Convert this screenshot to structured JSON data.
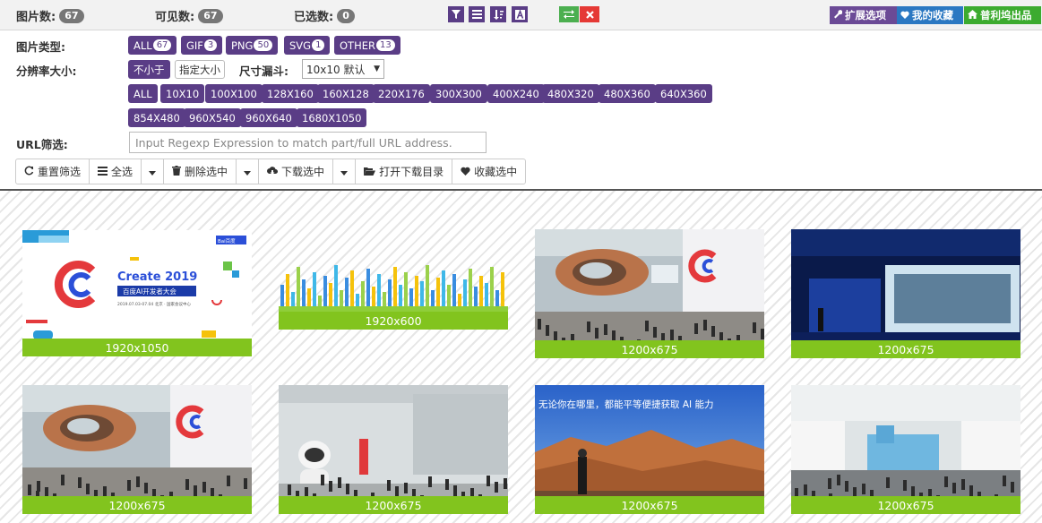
{
  "stats": {
    "images_label": "图片数:",
    "images_count": "67",
    "visible_label": "可见数:",
    "visible_count": "67",
    "selected_label": "已选数:",
    "selected_count": "0"
  },
  "ext_buttons": {
    "extend": "扩展选项",
    "favorites": "我的收藏",
    "brand": "普利坞出品"
  },
  "filters": {
    "type_label": "图片类型:",
    "types": [
      {
        "label": "ALL",
        "count": "67"
      },
      {
        "label": "GIF",
        "count": "3"
      },
      {
        "label": "PNG",
        "count": "50"
      },
      {
        "label": "SVG",
        "count": "1"
      },
      {
        "label": "OTHER",
        "count": "13"
      }
    ],
    "resolution_label": "分辨率大小:",
    "res_mode_active": "不小于",
    "res_mode_other": "指定大小",
    "funnel_label": "尺寸漏斗:",
    "funnel_value": "10x10 默认",
    "sizes_row1": [
      "ALL",
      "10X10",
      "100X100",
      "128X160",
      "160X128",
      "220X176",
      "300X300",
      "400X240",
      "480X320",
      "480X360",
      "640X360"
    ],
    "sizes_row2": [
      "854X480",
      "960X540",
      "960X640",
      "1680X1050"
    ],
    "url_label": "URL筛选:",
    "url_placeholder": "Input Regexp Expression to match part/full URL address."
  },
  "actions": {
    "reset": "重置筛选",
    "select_all": "全选",
    "delete_selected": "删除选中",
    "download_selected": "下载选中",
    "open_download_dir": "打开下载目录",
    "favorite_selected": "收藏选中"
  },
  "thumbnails": [
    {
      "size": "1920x1050"
    },
    {
      "size": "1920x600"
    },
    {
      "size": "1200x675"
    },
    {
      "size": "1200x675"
    },
    {
      "size": "1200x675"
    },
    {
      "size": "1200x675"
    },
    {
      "size": "1200x675"
    },
    {
      "size": "1200x675"
    }
  ],
  "thumb_text": {
    "create_title": "Create 2019",
    "create_sub": "百度AI开发者大会",
    "create_date": "2019.07.03-07.04  北京 · 国家会议中心",
    "baidu_logo": "Bai百度",
    "banner_slogan": "无论你在哪里，都能平等便捷获取 AI 能力"
  },
  "colors": {
    "accent_purple": "#5a3d86",
    "caption_green": "#82c41e",
    "ext_purple": "#6b4a96",
    "fav_blue": "#2b78c2",
    "brand_green": "#3cab2f"
  }
}
